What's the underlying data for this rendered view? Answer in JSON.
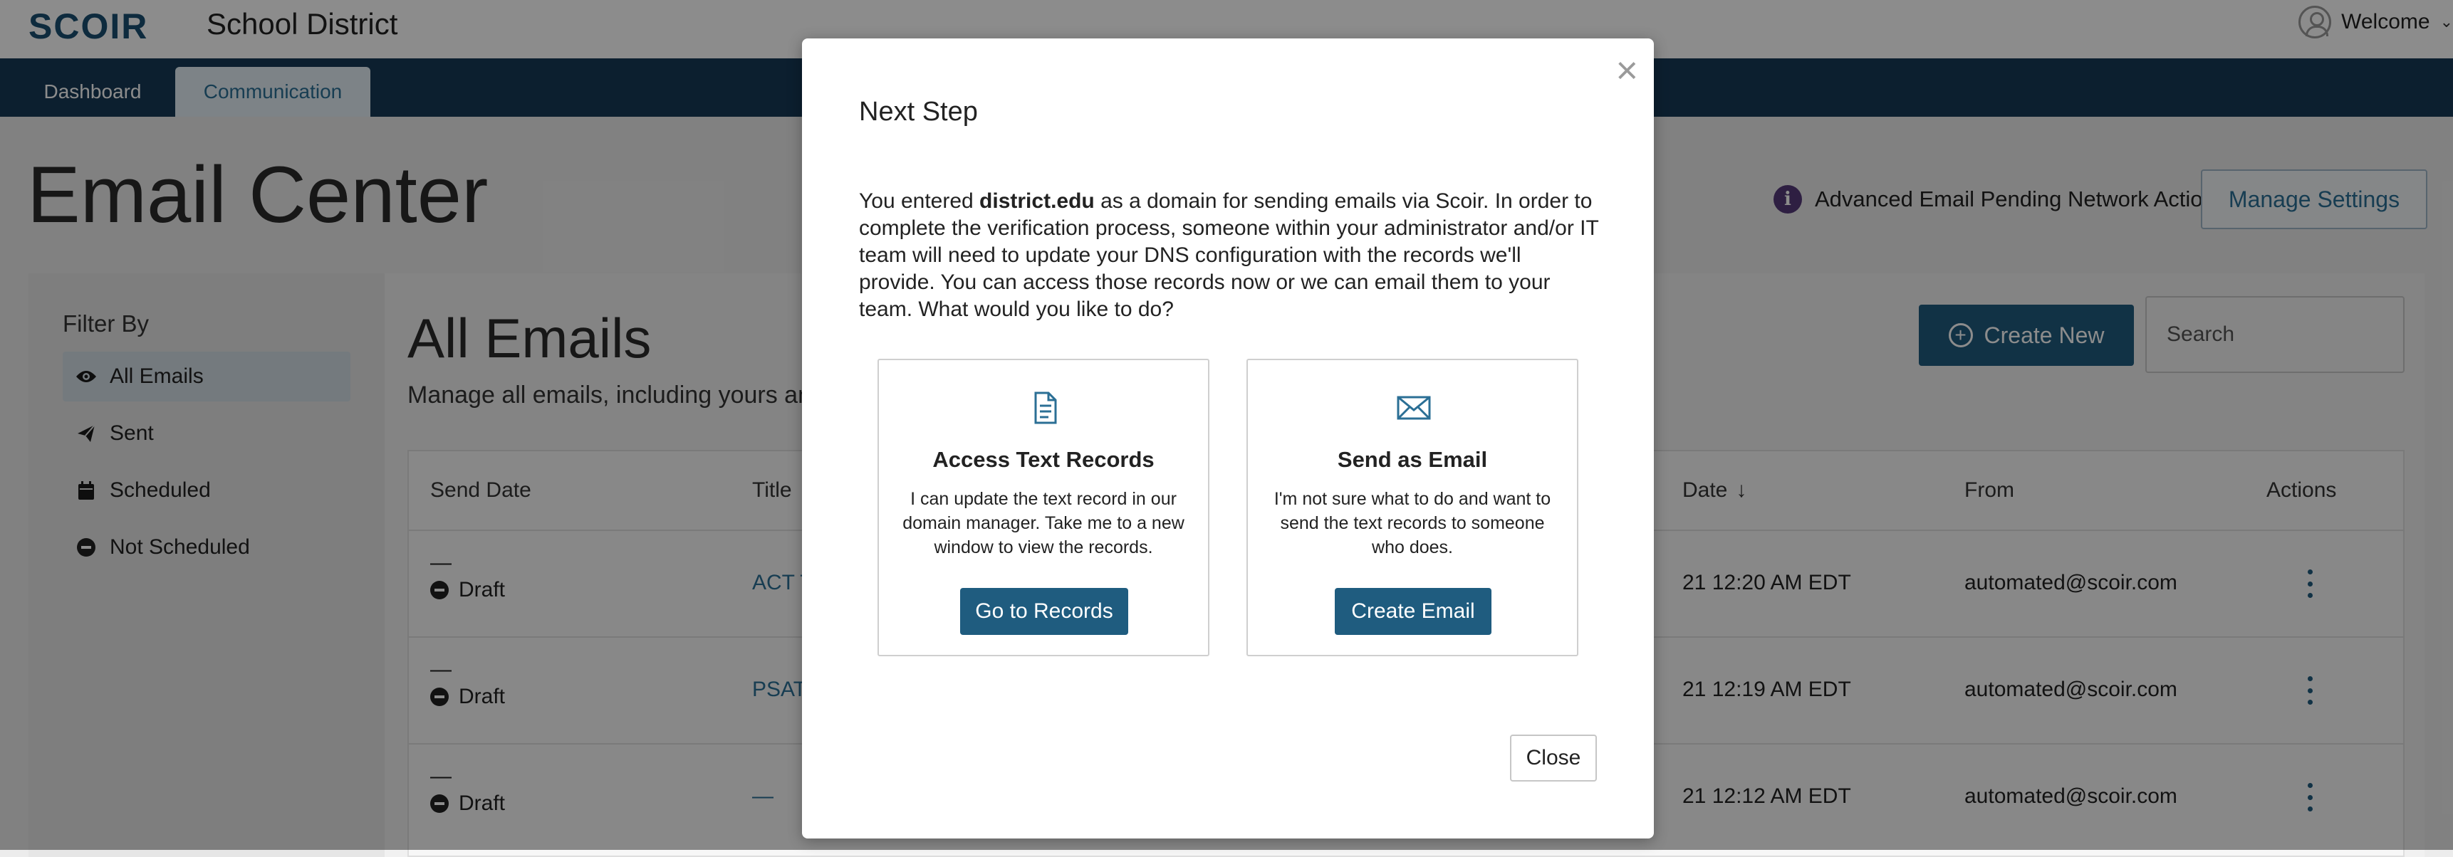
{
  "header": {
    "logo": "SCOIR",
    "school": "School District",
    "welcome": "Welcome",
    "avatar_icon": "user-circle-icon",
    "caret_icon": "chevron-down-icon"
  },
  "nav": {
    "tabs": [
      {
        "label": "Dashboard",
        "active": false
      },
      {
        "label": "Communication",
        "active": true
      }
    ]
  },
  "page": {
    "title": "Email Center",
    "pending_text": "Advanced Email Pending Network Action",
    "info_icon": "info-icon",
    "manage_settings": "Manage Settings"
  },
  "filter": {
    "title": "Filter By",
    "items": [
      {
        "label": "All Emails",
        "icon": "eye-icon",
        "active": true
      },
      {
        "label": "Sent",
        "icon": "paper-plane-icon",
        "active": false
      },
      {
        "label": "Scheduled",
        "icon": "calendar-icon",
        "active": false
      },
      {
        "label": "Not Scheduled",
        "icon": "minus-circle-icon",
        "active": false
      }
    ]
  },
  "main": {
    "title": "All Emails",
    "subtitle": "Manage all emails, including yours an",
    "create_new": "Create New",
    "search_placeholder": "Search",
    "columns": {
      "send_date": "Send Date",
      "title": "Title",
      "date": "Date",
      "from": "From",
      "actions": "Actions"
    },
    "rows": [
      {
        "send_date": "—",
        "status": "Draft",
        "title": "ACT T",
        "date": "21 12:20 AM EDT",
        "from": "automated@scoir.com"
      },
      {
        "send_date": "—",
        "status": "Draft",
        "title": "PSAT",
        "date": "21 12:19 AM EDT",
        "from": "automated@scoir.com"
      },
      {
        "send_date": "—",
        "status": "Draft",
        "title": "—",
        "date": "21 12:12 AM EDT",
        "from": "automated@scoir.com"
      }
    ]
  },
  "modal": {
    "title": "Next Step",
    "body_prefix": "You entered ",
    "domain": "district.edu",
    "body_suffix": " as a domain for sending emails via Scoir. In order to complete the verification process, someone within your administrator and/or IT team will need to update your DNS configuration with the records we'll provide. You can access those records now or we can email them to your team. What would you like to do?",
    "options": [
      {
        "icon": "document-icon",
        "title": "Access Text Records",
        "description": "I can update the text record in our domain manager. Take me to a new window to view the records.",
        "button": "Go to Records"
      },
      {
        "icon": "envelope-icon",
        "title": "Send as Email",
        "description": "I'm not sure what to do and want to send the text records to someone who does.",
        "button": "Create Email"
      }
    ],
    "close_label": "Close",
    "close_icon": "close-icon"
  },
  "colors": {
    "nav_bg": "#163a57",
    "primary": "#1f5c7f",
    "link": "#2b6f95",
    "info": "#553a78"
  }
}
